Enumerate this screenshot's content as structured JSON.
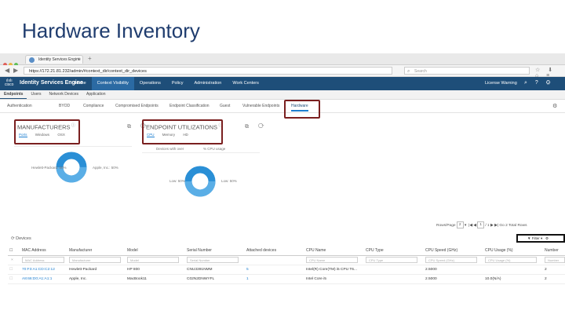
{
  "slide": {
    "title": "Hardware Inventory"
  },
  "browser": {
    "tab_title": "Identity Services Engine",
    "url": "https://172.21.81.232/admin/#context_dir/context_dir_devices",
    "search_placeholder": "Search",
    "back_icon": "back-arrow-icon",
    "forward_icon": "forward-arrow-icon"
  },
  "header": {
    "product": "Identity Services Engine",
    "nav": [
      "Home",
      "Context Visibility",
      "Operations",
      "Policy",
      "Administration",
      "Work Centers"
    ],
    "active_nav": "Context Visibility",
    "license": "License Warning"
  },
  "subnav": [
    "Endpoints",
    "Users",
    "Network Devices",
    "Application"
  ],
  "dash_tabs": [
    "Authentication",
    "BYOD",
    "Compliance",
    "Compromised Endpoints",
    "Endpoint Classification",
    "Guest",
    "Vulnerable Endpoints",
    "Hardware"
  ],
  "manufacturers": {
    "title": "MANUFACTURERS",
    "tabs": [
      "Ports",
      "Windows",
      "OSX"
    ],
    "label_left": "Hewlett-Packard: 50%",
    "label_right": "Apple, Inc.: 50%"
  },
  "utilizations": {
    "title": "ENDPOINT UTILIZATIONS",
    "tabs": [
      "CPU",
      "Memory",
      "HD"
    ],
    "col1": "Devices with over",
    "col2": "% CPU usage",
    "label_left": "Low: 50%",
    "label_right": "Low: 50%"
  },
  "pager": {
    "rows_label": "Rows/Page",
    "rows_value": "2",
    "page_value": "1",
    "of_label": "/ 1",
    "go_label": "Go",
    "total": "2 Total Rows"
  },
  "devices": {
    "title": "Devices",
    "filter_label": "Filter",
    "columns": [
      "MAC Address",
      "Manufacturer",
      "Model",
      "Serial Number",
      "Attached devices",
      "CPU Name",
      "CPU Type",
      "CPU Speed (GHz)",
      "CPU Usage (%)",
      "Number"
    ],
    "filters": [
      "MAC Address",
      "Manufacturer",
      "Model",
      "Serial Number",
      "",
      "CPU Name",
      "CPU Type",
      "CPU Speed (GHz)",
      "CPU Usage (%)",
      "Number"
    ],
    "rows": [
      [
        "70:F3:A1:CD:C2:12",
        "Hewlett-Packard",
        "HP 800",
        "CNU3391NMM",
        "5",
        "Intel(R) Core(TM) i5 CPU T6...",
        "",
        "2.5000",
        "",
        "2"
      ],
      [
        "A8:66:D0:A1:A1:1",
        "Apple, Inc.",
        "MacBook11",
        "C02N2DNWYFL",
        "1",
        "Intel Core i5",
        "",
        "2.5000",
        "10.0(N/A)",
        "2"
      ]
    ]
  },
  "colors": {
    "header_bg": "#1e4e79",
    "accent": "#1e7fd0",
    "donut": "#2a8fd6",
    "highlight": "#7a1f1f"
  }
}
